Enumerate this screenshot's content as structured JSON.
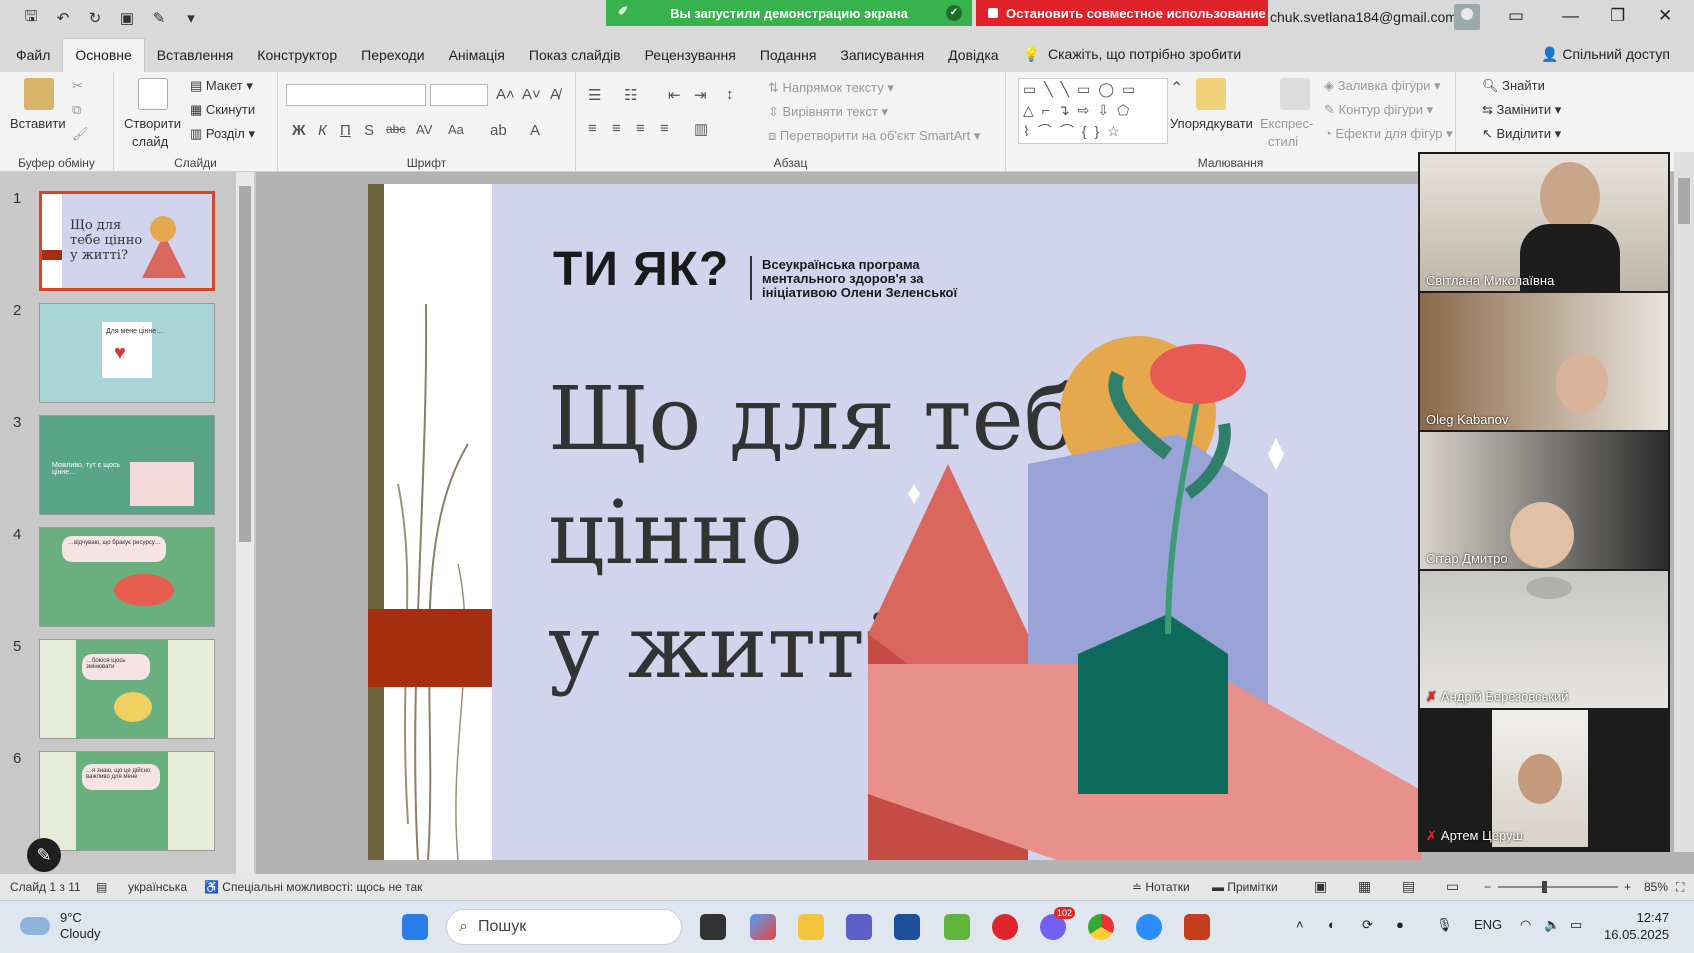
{
  "titlebar": {
    "share_status": "Вы запустили демонстрацию экрана",
    "stop_share": "Остановить совместное использование",
    "user_email": "chuk.svetlana184@gmail.com"
  },
  "tabs": [
    "Файл",
    "Основне",
    "Вставлення",
    "Конструктор",
    "Переходи",
    "Анімація",
    "Показ слайдів",
    "Рецензування",
    "Подання",
    "Записування",
    "Довідка"
  ],
  "tell_me": "Скажіть, що потрібно зробити",
  "share_button": "Спільний доступ",
  "ribbon": {
    "paste": "Вставити",
    "clipboard_group": "Буфер обміну",
    "new_slide_1": "Створити",
    "new_slide_2": "слайд",
    "layout": "Макет",
    "reset": "Скинути",
    "section": "Розділ",
    "slides_group": "Слайди",
    "font_group": "Шрифт",
    "text_direction": "Напрямок тексту",
    "align_text": "Вирівняти текст",
    "smartart": "Перетворити на об'єкт SmartArt",
    "paragraph_group": "Абзац",
    "arrange": "Упорядкувати",
    "quick_styles_1": "Експрес-",
    "quick_styles_2": "стилі",
    "shape_fill": "Заливка фігури",
    "shape_outline": "Контур фігури",
    "shape_effects": "Ефекти для фігур",
    "drawing_group": "Малювання",
    "find": "Знайти",
    "replace": "Замінити",
    "select": "Виділити"
  },
  "thumbnails": [
    {
      "num": "1",
      "text": "Що для тебе цінно у житті?",
      "bg": "#d2d4ee"
    },
    {
      "num": "2",
      "text": "Для мене цінне…",
      "bg": "#a8d4d6"
    },
    {
      "num": "3",
      "text": "Можливо, тут є щось цінне…",
      "bg": "#5aa58a"
    },
    {
      "num": "4",
      "text": "…відчуваю, що бракує ресурсу…",
      "bg": "#6ab07e"
    },
    {
      "num": "5",
      "text": "…боюся щось змінювати",
      "bg": "#6ab07e"
    },
    {
      "num": "6",
      "text": "…я знаю, що це дійсно важливо для мене",
      "bg": "#6ab07e"
    }
  ],
  "slide": {
    "logo": "ТИ ЯК?",
    "logo_sub": "Всеукраїнська програма ментального здоров'я за ініціативою Олени Зеленської",
    "title_line1": "Що для тебе",
    "title_line2": "цінно",
    "title_line3": "у житті?"
  },
  "participants": [
    {
      "name": "Світлана Миколаївна",
      "muted": false,
      "active": false
    },
    {
      "name": "Oleg Kabanov",
      "muted": false,
      "active": false
    },
    {
      "name": "Сітар Дмитро",
      "muted": false,
      "active": true
    },
    {
      "name": "Андрій Березовський",
      "muted": true,
      "active": false
    },
    {
      "name": "Артем Церуш",
      "muted": true,
      "active": false
    }
  ],
  "statusbar": {
    "slide_count": "Слайд 1 з 11",
    "language": "українська",
    "accessibility": "Спеціальні можливості: щось не так",
    "notes": "Нотатки",
    "comments": "Примітки",
    "zoom": "85%"
  },
  "taskbar": {
    "temp": "9°C",
    "weather": "Cloudy",
    "search": "Пошук",
    "badge": "102",
    "lang": "ENG",
    "time": "12:47",
    "date": "16.05.2025"
  }
}
